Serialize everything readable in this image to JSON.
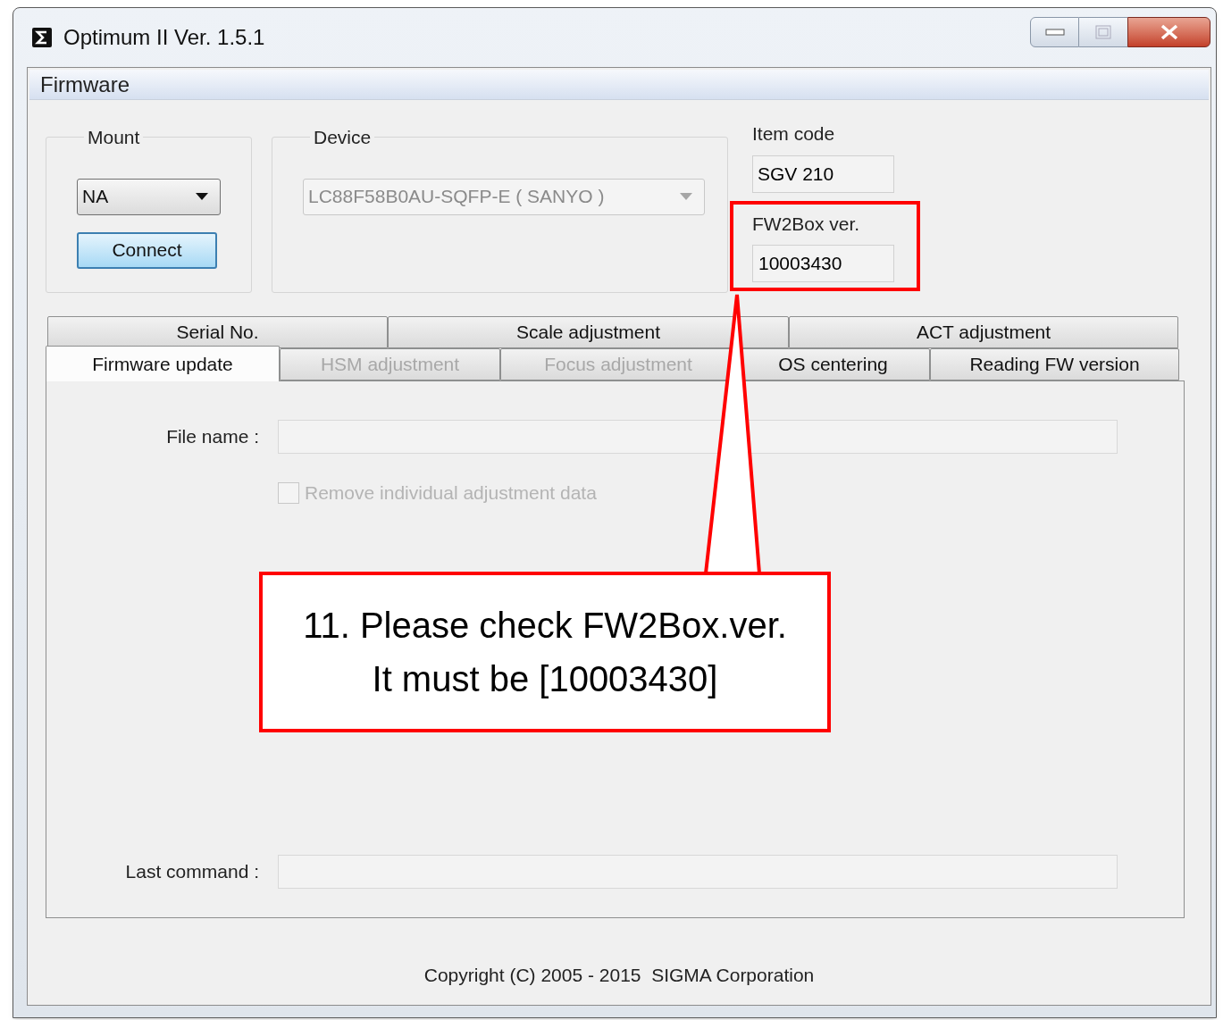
{
  "window": {
    "title": "Optimum II Ver. 1.5.1"
  },
  "section_header": "Firmware",
  "mount": {
    "label": "Mount",
    "dropdown": {
      "value": "NA",
      "disabled": false
    },
    "connect_button": "Connect"
  },
  "device": {
    "label": "Device",
    "dropdown": {
      "value": "LC88F58B0AU-SQFP-E ( SANYO )",
      "disabled": true
    }
  },
  "item_code": {
    "label": "Item code",
    "value": "SGV 210"
  },
  "fw2box": {
    "label": "FW2Box ver.",
    "value": "10003430",
    "highlighted": true
  },
  "tab_rows": [
    [
      {
        "label": "Serial No.",
        "selected": false,
        "disabled": false
      },
      {
        "label": "Scale adjustment",
        "selected": false,
        "disabled": false
      },
      {
        "label": "ACT adjustment",
        "selected": false,
        "disabled": false
      }
    ],
    [
      {
        "label": "Firmware update",
        "selected": true,
        "disabled": false
      },
      {
        "label": "HSM adjustment",
        "selected": false,
        "disabled": true
      },
      {
        "label": "Focus adjustment",
        "selected": false,
        "disabled": true
      },
      {
        "label": "OS centering",
        "selected": false,
        "disabled": false
      },
      {
        "label": "Reading FW version",
        "selected": false,
        "disabled": false
      }
    ]
  ],
  "file_name": {
    "label": "File name :"
  },
  "remove_checkbox": {
    "label": "Remove individual adjustment data",
    "checked": false,
    "disabled": true
  },
  "last_command": {
    "label": "Last command :"
  },
  "copyright": "Copyright (C) 2005 - 2015  SIGMA Corporation",
  "callout": {
    "lines": [
      "11. Please check FW2Box.ver.",
      "It must be [10003430]"
    ]
  }
}
